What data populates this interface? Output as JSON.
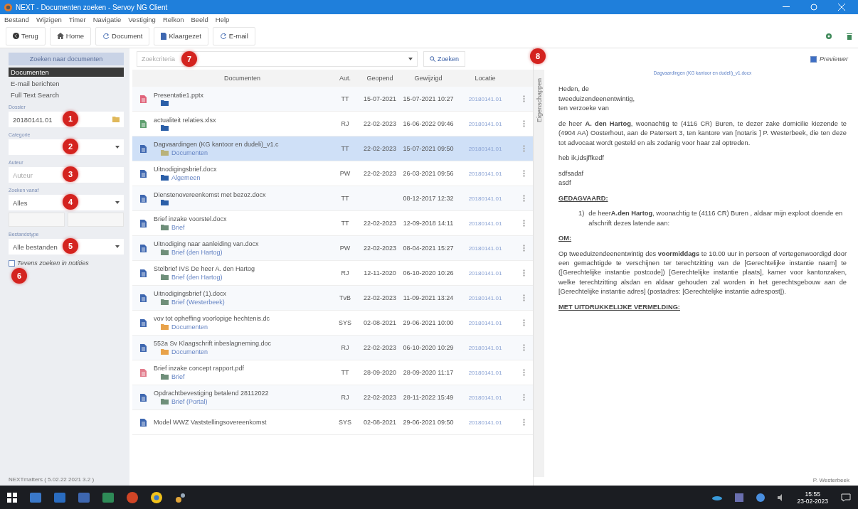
{
  "window": {
    "title": "NEXT - Documenten zoeken - Servoy NG Client"
  },
  "menu": [
    "Bestand",
    "Wijzigen",
    "Timer",
    "Navigatie",
    "Vestiging",
    "Relkon",
    "Beeld",
    "Help"
  ],
  "toolbar": [
    {
      "kind": "back",
      "label": "Terug"
    },
    {
      "kind": "home",
      "label": "Home"
    },
    {
      "kind": "document",
      "label": "Document"
    },
    {
      "kind": "clipboard",
      "label": "Klaargezet"
    },
    {
      "kind": "mail",
      "label": "E-mail"
    }
  ],
  "sidebar": {
    "header": "Zoeken naar documenten",
    "modes": [
      {
        "label": "Documenten",
        "selected": true
      },
      {
        "label": "E-mail berichten",
        "selected": false
      },
      {
        "label": "Full Text Search",
        "selected": false
      }
    ],
    "fields": [
      {
        "kind": "input-button",
        "label": "Dossier",
        "value": "20180141.01",
        "marker": "1"
      },
      {
        "kind": "select",
        "label": "Categorie",
        "marker": "2"
      },
      {
        "kind": "input",
        "label": "Auteur",
        "placeholder": "Auteur",
        "marker": "3"
      },
      {
        "kind": "select",
        "label": "Zoeken vanaf",
        "value": "Alles",
        "marker": "4"
      },
      {
        "kind": "date-pair"
      },
      {
        "kind": "select",
        "label": "Bestandstype",
        "value": "Alle bestanden",
        "marker": "5"
      }
    ],
    "checkbox": {
      "label": "Tevens zoeken in notities",
      "checked": false,
      "marker": "6"
    }
  },
  "search": {
    "placeholder": "Zoekcriteria",
    "marker": "7",
    "button": "Zoeken"
  },
  "table": {
    "columns": [
      "Documenten",
      "Aut.",
      "Geopend",
      "Gewijzigd",
      "Locatie"
    ],
    "rows": [
      {
        "kind": "pptx",
        "name": "Presentatie1.pptx",
        "folder": {
          "color": "#2b5fa8"
        },
        "author": "TT",
        "opened": "15-07-2021",
        "modified": "15-07-2021 10:27",
        "location": "20180141.01",
        "selected": false
      },
      {
        "kind": "xlsx",
        "name": "actualiteit relaties.xlsx",
        "folder": {
          "color": "#2b5fa8"
        },
        "author": "RJ",
        "opened": "22-02-2023",
        "modified": "16-06-2022 09:46",
        "location": "20180141.01",
        "selected": false
      },
      {
        "kind": "docx",
        "name": "Dagvaardingen (KG kantoor en dudeli)_v1.c",
        "folder": {
          "color": "#b9b27a",
          "label": "Documenten"
        },
        "author": "TT",
        "opened": "22-02-2023",
        "modified": "15-07-2021 09:50",
        "location": "20180141.01",
        "selected": true
      },
      {
        "kind": "docx",
        "name": "Uitnodigingsbrief.docx",
        "folder": {
          "color": "#2b5fa8",
          "label": "Algemeen"
        },
        "author": "PW",
        "opened": "22-02-2023",
        "modified": "26-03-2021 09:56",
        "location": "20180141.01",
        "selected": false
      },
      {
        "kind": "docx",
        "name": "Dienstenovereenkomst met bezoz.docx",
        "folder": {
          "color": "#2b5fa8"
        },
        "author": "TT",
        "modified": "08-12-2017 12:32",
        "location": "20180141.01",
        "selected": false
      },
      {
        "kind": "docx",
        "name": "Brief inzake voorstel.docx",
        "folder": {
          "color": "#6f8f7a",
          "label": "Brief"
        },
        "author": "TT",
        "opened": "22-02-2023",
        "modified": "12-09-2018 14:11",
        "location": "20180141.01",
        "selected": false
      },
      {
        "kind": "docx",
        "name": "Uitnodiging naar aanleiding van.docx",
        "folder": {
          "color": "#6f8f7a",
          "label": "Brief  (den Hartog)"
        },
        "author": "PW",
        "opened": "22-02-2023",
        "modified": "08-04-2021 15:27",
        "location": "20180141.01",
        "selected": false
      },
      {
        "kind": "docx",
        "name": "Stelbrief IVS De heer A. den Hartog",
        "folder": {
          "color": "#6f8f7a",
          "label": "Brief  (den Hartog)"
        },
        "author": "RJ",
        "opened": "12-11-2020",
        "modified": "06-10-2020 10:26",
        "location": "20180141.01",
        "selected": false
      },
      {
        "kind": "docx",
        "name": "Uitnodigingsbrief (1).docx",
        "folder": {
          "color": "#6f8f7a",
          "label": "Brief  (Westerbeek)"
        },
        "author": "TvB",
        "opened": "22-02-2023",
        "modified": "11-09-2021 13:24",
        "location": "20180141.01",
        "selected": false
      },
      {
        "kind": "docx",
        "name": "vov tot opheffing voorlopige hechtenis.dc",
        "folder": {
          "color": "#e8a24a",
          "label": "Documenten"
        },
        "author": "SYS",
        "opened": "02-08-2021",
        "modified": "29-06-2021 10:00",
        "location": "20180141.01",
        "selected": false
      },
      {
        "kind": "docx",
        "name": "552a Sv Klaagschrift inbeslagneming.doc",
        "folder": {
          "color": "#e8a24a",
          "label": "Documenten"
        },
        "author": "RJ",
        "opened": "22-02-2023",
        "modified": "06-10-2020 10:29",
        "location": "20180141.01",
        "selected": false
      },
      {
        "kind": "pdf",
        "name": "Brief inzake concept rapport.pdf",
        "folder": {
          "color": "#6f8f7a",
          "label": "Brief"
        },
        "author": "TT",
        "opened": "28-09-2020",
        "modified": "28-09-2020 11:17",
        "location": "20180141.01",
        "selected": false
      },
      {
        "kind": "docx",
        "name": "Opdrachtbevestiging betalend 28112022",
        "folder": {
          "color": "#6f8f7a",
          "label": "Brief  (Portal)"
        },
        "author": "RJ",
        "opened": "22-02-2023",
        "modified": "28-11-2022 15:49",
        "location": "20180141.01",
        "selected": false
      },
      {
        "kind": "docx",
        "name": "Model WWZ Vaststellingsovereenkomst",
        "author": "SYS",
        "opened": "02-08-2021",
        "modified": "29-06-2021 09:50",
        "location": "20180141.01",
        "selected": false
      }
    ]
  },
  "preview": {
    "checkbox": {
      "label": "Previewer",
      "checked": true
    },
    "marker": "8",
    "side_tab": "Eigenschappen",
    "file_link": "Dagvaardingen (KG kantoor en dudeli)_v1.docx",
    "paragraphs": [
      {
        "kind": "text",
        "text": "Heden, de\ntweeduizendeenentwintig,\nten verzoeke van"
      },
      {
        "kind": "text",
        "text": "de heer **A. den Hartog**, woonachtig te (4116 CR) Buren, te dezer zake domicilie kiezende te (4904 AA) Oosterhout, aan de Patersert 3, ten kantore van [notaris ] P. Westerbeek, die ten deze tot advocaat wordt gesteld en als zodanig voor haar zal optreden."
      },
      {
        "kind": "text",
        "text": "heb ik,idsjffkedf"
      },
      {
        "kind": "text",
        "text": "sdfsadaf\nasdf"
      },
      {
        "kind": "heading",
        "text": "GEDAGVAARD:"
      },
      {
        "kind": "numbered",
        "number": "1)",
        "text": "de heer**A.den Hartog**, woonachtig te (4116 CR) Buren , aldaar mijn exploot doende en afschrift dezes latende aan:"
      },
      {
        "kind": "heading",
        "text": "OM:"
      },
      {
        "kind": "text",
        "text": "Op tweeduizendeenentwintig des **voormiddags** te 10.00 uur in persoon of vertegenwoordigd door een gemachtigde te verschijnen ter terechtzitting van de [Gerechtelijke instantie naam] te ([Gerechtelijke instantie postcode]) [Gerechtelijke instantie plaats], kamer voor kantonzaken, welke terechtzitting alsdan en aldaar gehouden zal worden in het gerechtsgebouw aan de [Gerechtelijke instantie adres] (postadres: [Gerechtelijke instantie adrespost])."
      },
      {
        "kind": "heading",
        "text": "MET UITDRUKKELIJKE VERMELDING:"
      }
    ]
  },
  "status": {
    "version": "NEXTmatters ( 5.02.22 2021 3.2 )",
    "user": "P. Westerbeek"
  },
  "taskbar": {
    "time": "15:55",
    "date": "23-02-2023"
  }
}
